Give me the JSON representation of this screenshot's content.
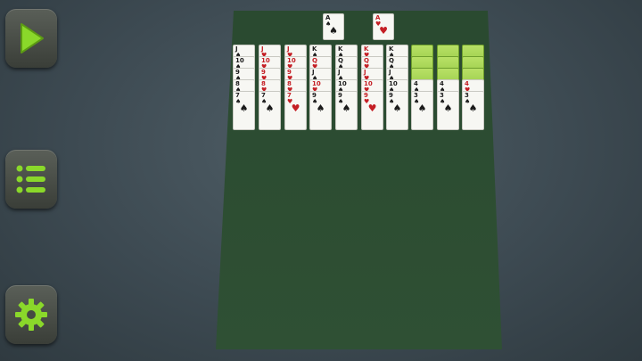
{
  "sidebar": {
    "play_button": {
      "icon": "play-icon",
      "color": "#8ad82a"
    },
    "menu_button": {
      "icon": "menu-icon",
      "color": "#8ad82a"
    },
    "settings_button": {
      "icon": "gear-icon",
      "color": "#8ad82a"
    }
  },
  "felt_color": "#2f4a32",
  "foundations": [
    {
      "rank": "A",
      "suit": "♠",
      "color": "black"
    },
    {
      "rank": "A",
      "suit": "♥",
      "color": "red"
    }
  ],
  "tableau": [
    {
      "face_down": 0,
      "cards": [
        [
          "J",
          "♠",
          "black"
        ],
        [
          "10",
          "♠",
          "black"
        ],
        [
          "9",
          "♠",
          "black"
        ],
        [
          "8",
          "♠",
          "black"
        ],
        [
          "7",
          "♠",
          "black"
        ]
      ]
    },
    {
      "face_down": 0,
      "cards": [
        [
          "J",
          "♥",
          "red"
        ],
        [
          "10",
          "♥",
          "red"
        ],
        [
          "9",
          "♥",
          "red"
        ],
        [
          "8",
          "♥",
          "red"
        ],
        [
          "7",
          "♠",
          "black"
        ]
      ]
    },
    {
      "face_down": 0,
      "cards": [
        [
          "J",
          "♥",
          "red"
        ],
        [
          "10",
          "♥",
          "red"
        ],
        [
          "9",
          "♥",
          "red"
        ],
        [
          "8",
          "♥",
          "red"
        ],
        [
          "7",
          "♥",
          "red"
        ]
      ]
    },
    {
      "face_down": 0,
      "cards": [
        [
          "K",
          "♠",
          "black"
        ],
        [
          "Q",
          "♥",
          "red"
        ],
        [
          "J",
          "♠",
          "black"
        ],
        [
          "10",
          "♥",
          "red"
        ],
        [
          "9",
          "♠",
          "black"
        ]
      ]
    },
    {
      "face_down": 0,
      "cards": [
        [
          "K",
          "♠",
          "black"
        ],
        [
          "Q",
          "♠",
          "black"
        ],
        [
          "J",
          "♠",
          "black"
        ],
        [
          "10",
          "♠",
          "black"
        ],
        [
          "9",
          "♠",
          "black"
        ]
      ]
    },
    {
      "face_down": 0,
      "cards": [
        [
          "K",
          "♥",
          "red"
        ],
        [
          "Q",
          "♥",
          "red"
        ],
        [
          "J",
          "♥",
          "red"
        ],
        [
          "10",
          "♥",
          "red"
        ],
        [
          "9",
          "♥",
          "red"
        ]
      ]
    },
    {
      "face_down": 0,
      "cards": [
        [
          "K",
          "♠",
          "black"
        ],
        [
          "Q",
          "♠",
          "black"
        ],
        [
          "J",
          "♠",
          "black"
        ],
        [
          "10",
          "♠",
          "black"
        ],
        [
          "9",
          "♠",
          "black"
        ]
      ]
    },
    {
      "face_down": 3,
      "cards": [
        [
          "4",
          "♠",
          "black"
        ],
        [
          "3",
          "♠",
          "black"
        ]
      ]
    },
    {
      "face_down": 3,
      "cards": [
        [
          "4",
          "♠",
          "black"
        ],
        [
          "3",
          "♠",
          "black"
        ]
      ]
    },
    {
      "face_down": 3,
      "cards": [
        [
          "4",
          "♥",
          "red"
        ],
        [
          "3",
          "♠",
          "black"
        ]
      ]
    }
  ]
}
